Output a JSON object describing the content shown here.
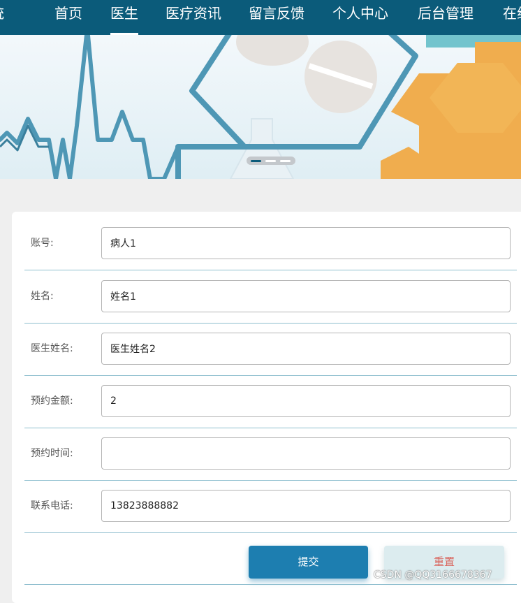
{
  "nav": {
    "brand_fragment": "统",
    "items": [
      {
        "label": "首页"
      },
      {
        "label": "医生"
      },
      {
        "label": "医疗资讯"
      },
      {
        "label": "留言反馈"
      },
      {
        "label": "个人中心"
      },
      {
        "label": "后台管理"
      },
      {
        "label": "在线"
      }
    ],
    "active_index": 1
  },
  "banner": {
    "slide_count": 3,
    "active_slide": 0
  },
  "form": {
    "fields": [
      {
        "label": "账号:",
        "value": "病人1",
        "placeholder": ""
      },
      {
        "label": "姓名:",
        "value": "姓名1",
        "placeholder": ""
      },
      {
        "label": "医生姓名:",
        "value": "医生姓名2",
        "placeholder": ""
      },
      {
        "label": "预约金额:",
        "value": "2",
        "placeholder": ""
      },
      {
        "label": "预约时间:",
        "value": "",
        "placeholder": ""
      },
      {
        "label": "联系电话:",
        "value": "13823888882",
        "placeholder": ""
      }
    ],
    "submit_label": "提交",
    "reset_label": "重置"
  },
  "watermark": "CSDN @QQ3166678367",
  "colors": {
    "nav_bg": "#0b5b7a",
    "primary": "#1d7eb0",
    "reset_bg": "#dcecef",
    "reset_text": "#d9675f",
    "divider": "#8fbfcf"
  }
}
